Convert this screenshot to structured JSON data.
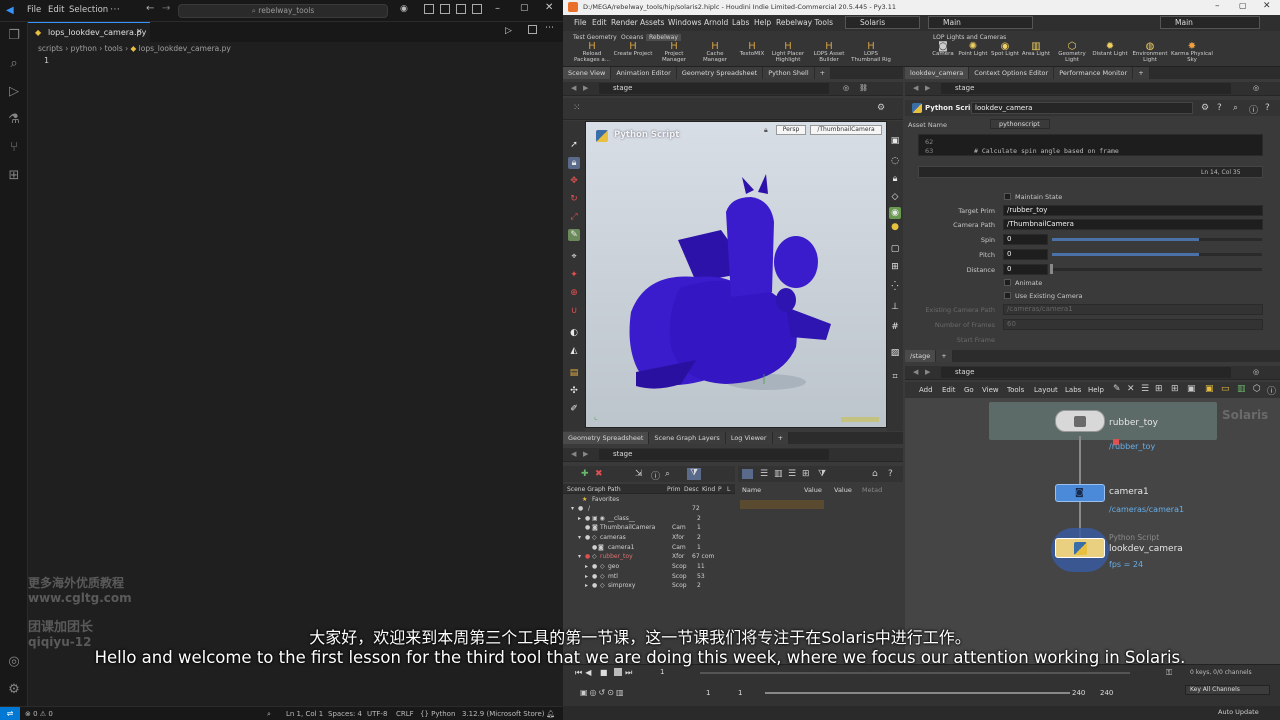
{
  "vscode": {
    "menu": [
      "File",
      "Edit",
      "Selection"
    ],
    "search": "rebelway_tools",
    "tab_label": "lops_lookdev_camera.py",
    "breadcrumb": [
      "scripts",
      "python",
      "tools",
      "lops_lookdev_camera.py"
    ],
    "line_number": "1",
    "status": {
      "errors": "0",
      "warnings": "0",
      "position": "Ln 1, Col 1",
      "spaces": "Spaces: 4",
      "encoding": "UTF-8",
      "eol": "CRLF",
      "language": "Python",
      "version": "3.12.9 (Microsoft Store)"
    },
    "watermark": [
      "更多海外优质教程",
      "www.cgltg.com",
      "团课加团长",
      "qiqiyu-12"
    ]
  },
  "houdini": {
    "title": "D:/MEGA/rebelway_tools/hip/solaris2.hiplc - Houdini Indie Limited-Commercial 20.5.445 - Py3.11",
    "menu": [
      "File",
      "Edit",
      "Render",
      "Assets",
      "Windows",
      "Arnold",
      "Labs",
      "Help",
      "Rebelway Tools"
    ],
    "desktop": "Solaris",
    "main_left": "Main",
    "main_right": "Main",
    "shelf_tabs_left": [
      "Test Geometry",
      "Oceans",
      "Rebelway"
    ],
    "shelf_tabs_right": [
      "LOP Lights and Cameras"
    ],
    "shelf_left": [
      "Reload Packages a...",
      "Create Project",
      "Project Manager",
      "Cache Manager",
      "TextoMIX",
      "Light Placer Highlight",
      "LOPS Asset Builder",
      "LOPS Thumbnail Rig"
    ],
    "shelf_right": [
      "Camera",
      "Point Light",
      "Spot Light",
      "Area Light",
      "Geometry Light",
      "Distant Light",
      "Environment Light",
      "Karma Physical Sky"
    ],
    "top_left_tabs": [
      "Scene View",
      "Animation Editor",
      "Geometry Spreadsheet",
      "Python Shell"
    ],
    "top_right_tabs": [
      "lookdev_camera",
      "Context Options Editor",
      "Performance Monitor"
    ],
    "stage_label": "stage",
    "viewport": {
      "overlay_title": "Python Script",
      "persp": "Persp",
      "camera": "/ThumbnailCamera"
    },
    "params": {
      "node_type": "Python Script",
      "node_name": "lookdev_camera",
      "asset_name_label": "Asset Name",
      "asset_name_value": "pythonscript",
      "code_line_62": "62",
      "code_line_63": "63",
      "code_text": "# Calculate spin angle based on frame",
      "cursor_pos": "Ln 14, Col 35",
      "maintain_state": "Maintain State",
      "target_prim_label": "Target Prim",
      "target_prim_value": "/rubber_toy",
      "camera_path_label": "Camera Path",
      "camera_path_value": "/ThumbnailCamera",
      "spin_label": "Spin",
      "spin_value": "0",
      "spin_fraction": 0.7,
      "pitch_label": "Pitch",
      "pitch_value": "0",
      "pitch_fraction": 0.7,
      "distance_label": "Distance",
      "distance_value": "0",
      "animate": "Animate",
      "use_existing_camera": "Use Existing Camera",
      "existing_camera_label": "Existing Camera Path",
      "existing_camera_value": "/cameras/camera1",
      "num_frames_label": "Number of Frames",
      "num_frames_value": "60",
      "start_frame_label": "Start Frame"
    },
    "bottom_left_tabs": [
      "Geometry Spreadsheet",
      "Scene Graph Layers",
      "Log Viewer"
    ],
    "scene_graph": {
      "headers": [
        "Scene Graph Path",
        "Prim",
        "Desc",
        "Kind",
        "P",
        "L"
      ],
      "rows": [
        {
          "name": "Favorites",
          "prim": "",
          "desc": ""
        },
        {
          "name": "/",
          "prim": "",
          "desc": "72"
        },
        {
          "name": "__class__",
          "prim": "",
          "desc": "2"
        },
        {
          "name": "ThumbnailCamera",
          "prim": "Cam",
          "desc": "1"
        },
        {
          "name": "cameras",
          "prim": "Xfor",
          "desc": "2"
        },
        {
          "name": "camera1",
          "prim": "Cam",
          "desc": "1"
        },
        {
          "name": "rubber_toy",
          "prim": "Xfor",
          "desc": "67 com"
        },
        {
          "name": "geo",
          "prim": "Scop",
          "desc": "11"
        },
        {
          "name": "mtl",
          "prim": "Scop",
          "desc": "53"
        },
        {
          "name": "simproxy",
          "prim": "Scop",
          "desc": "2"
        }
      ],
      "attr_headers": [
        "Name",
        "Value"
      ],
      "value_headers": [
        "Value",
        "Metad"
      ]
    },
    "network": {
      "tab": "/stage",
      "path": "stage",
      "menu": [
        "Add",
        "Edit",
        "Go",
        "View",
        "Tools",
        "Layout",
        "Labs",
        "Help"
      ],
      "context_label": "Solaris",
      "nodes": [
        {
          "name": "rubber_toy",
          "path": "/rubber_toy",
          "type": ""
        },
        {
          "name": "camera1",
          "path": "/cameras/camera1",
          "type": ""
        },
        {
          "name": "lookdev_camera",
          "path": "fps = 24",
          "type": "Python Script"
        }
      ]
    },
    "timeline": {
      "frame": "1",
      "start": "1",
      "end": "240",
      "end2": "240",
      "keys": "0 keys, 0/0 channels",
      "key_all": "Key All Channels",
      "auto_update": "Auto Update"
    }
  },
  "subtitles": {
    "zh": "大家好，欢迎来到本周第三个工具的第一节课，这一节课我们将专注于在Solaris中进行工作。",
    "en": "Hello and welcome to the first lesson for the third tool that we are doing this week, where we focus our attention working in Solaris."
  },
  "colors": {
    "vscode_bg": "#1f1f1f",
    "houdini_bg": "#3a3a3a",
    "node_path_blue": "#67aee8",
    "duck_purple": "#3a1ccc"
  }
}
